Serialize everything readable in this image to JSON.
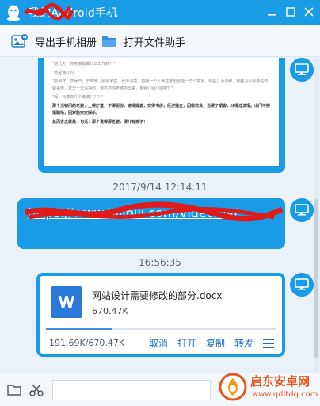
{
  "window": {
    "title": "我的Android手机",
    "accent_color": "#1a9be6",
    "controls": [
      "minimize-icon",
      "maximize-icon",
      "close-icon"
    ]
  },
  "toolbar": {
    "items": [
      {
        "label": "导出手机相册",
        "icon": "photo-export-icon"
      },
      {
        "label": "打开文件助手",
        "icon": "folder-icon"
      }
    ]
  },
  "messages": [
    {
      "type": "image",
      "lines": [
        "\"前几天，你老婆是做什么工作的？\"",
        "\"她是做IT的。\"",
        "\"都那样，双休日；早单晚，照顾家庭，长的漂亮，把她一个人养在家里也能一万个搞定，有些几小说稀，有些没事就要说你做事慢，家里十天清净的，要不然你老婆的出来，根我介绍介绍吧？\"",
        "\"呢，玩着你几个老婆？？？\"",
        "那个当初问的老婆，上得厅堂，下得厨房，进得媒婆，安得书房，经济独立，因根优良，当得了期客，斗得过流氓。出门可拼播职场，回家能安定娱乐。",
        "总而言之就是一句话：那个说得那老婆，得儿有孩子！"
      ]
    },
    {
      "type": "timestamp",
      "text": "2017/9/14 12:14:11"
    },
    {
      "type": "link",
      "text": "https://www.bilibili.com/video/av/"
    },
    {
      "type": "timestamp",
      "text": "16:56:35"
    },
    {
      "type": "file",
      "file_name": "网站设计需要修改的部分.docx",
      "file_size": "670.47K",
      "progress_text": "191.69K/670.47K",
      "progress": 0.286,
      "file_icon_letter": "W",
      "actions": [
        "取消",
        "打开",
        "复制",
        "转发"
      ]
    }
  ],
  "bottom_bar": {
    "icons": [
      "folder-icon",
      "scissors-icon"
    ],
    "input_value": ""
  },
  "watermark": {
    "title": "启东安卓网",
    "url": "www.qdltdq.com"
  }
}
